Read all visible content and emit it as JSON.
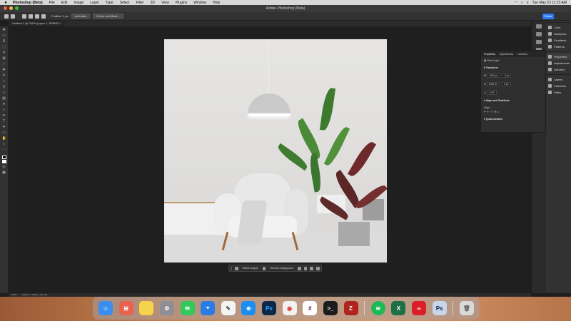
{
  "menubar": {
    "apple_label": "",
    "items": [
      "Photoshop (Beta)",
      "File",
      "Edit",
      "Image",
      "Layer",
      "Type",
      "Select",
      "Filter",
      "3D",
      "View",
      "Plugins",
      "Window",
      "Help"
    ],
    "datetime": "Tue May 23  11:23 AM"
  },
  "window": {
    "title": "Adobe Photoshop (Beta)"
  },
  "options_bar": {
    "feather_label": "Feather: 0 px",
    "antialias_label": "Anti-alias",
    "select_mask_label": "Select and Mask..."
  },
  "share_button": "Share",
  "document_tab": "Untitled-1 @ 200% (Layer 1, RGB/8*) *",
  "status_bar": {
    "zoom": "200%",
    "doc_size": "1000 px x 1000 px (72 ppi)"
  },
  "context_bar": {
    "select_subject": "Select subject",
    "remove_background": "Remove background"
  },
  "properties_panel": {
    "tabs": [
      "Properties",
      "Adjustments",
      "Libraries"
    ],
    "layer_type": "Pixel Layer",
    "transform_label": "Transform",
    "width_label": "W",
    "width_value": "1000 px",
    "height_label": "H",
    "height_value": "1000 px",
    "x_value": "0 px",
    "y_value": "0 px",
    "angle_value": "0.00°",
    "align_label": "Align and Distribute",
    "align_sub": "Align:",
    "quick_actions_label": "Quick Actions"
  },
  "right_dock": {
    "items": [
      "Color",
      "Swatches",
      "Gradients",
      "Patterns",
      "Properties",
      "Adjustments",
      "Libraries",
      "Layers",
      "Channels",
      "Paths"
    ]
  },
  "dock_apps": [
    "Finder",
    "Launchpad",
    "Notes",
    "System Settings",
    "Messages",
    "Maps",
    "TextEdit",
    "Safari",
    "Photoshop",
    "Chrome",
    "Slack",
    "Terminal",
    "FileZilla",
    "Spotify",
    "Excel",
    "Creative Cloud",
    "Photoshop Beta",
    "Trash"
  ]
}
